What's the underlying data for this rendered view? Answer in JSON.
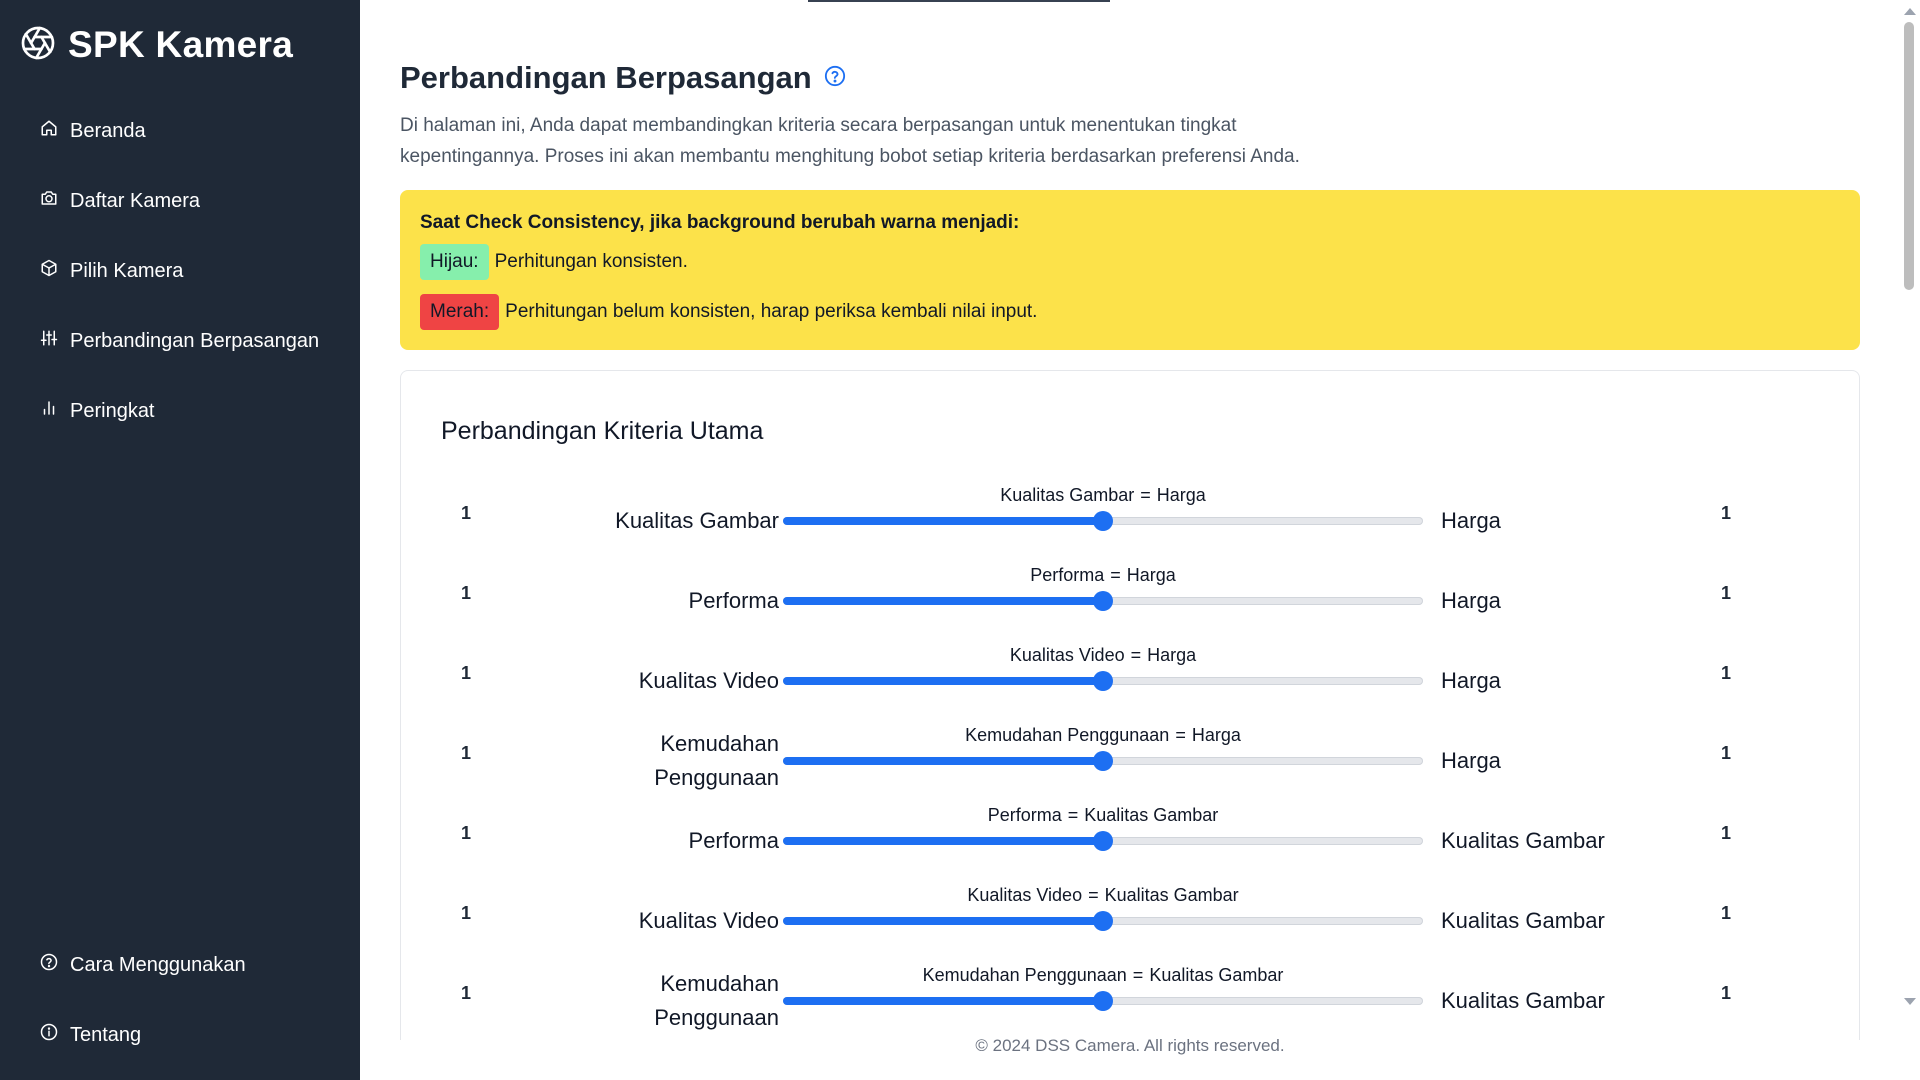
{
  "brand": {
    "name": "SPK Kamera",
    "icon": "aperture-icon"
  },
  "nav": {
    "items": [
      {
        "label": "Beranda",
        "icon": "home-icon"
      },
      {
        "label": "Daftar Kamera",
        "icon": "camera-icon"
      },
      {
        "label": "Pilih Kamera",
        "icon": "cube-icon"
      },
      {
        "label": "Perbandingan Berpasangan",
        "icon": "sliders-icon"
      },
      {
        "label": "Peringkat",
        "icon": "bar-chart-icon"
      }
    ],
    "bottom": [
      {
        "label": "Cara Menggunakan",
        "icon": "question-circle-icon"
      },
      {
        "label": "Tentang",
        "icon": "info-circle-icon"
      }
    ]
  },
  "page": {
    "title": "Perbandingan Berpasangan",
    "intro": "Di halaman ini, Anda dapat membandingkan kriteria secara berpasangan untuk menentukan tingkat kepentingannya. Proses ini akan membantu menghitung bobot setiap kriteria berdasarkan preferensi Anda."
  },
  "notice": {
    "title": "Saat Check Consistency, jika background berubah warna menjadi:",
    "green_badge": "Hijau:",
    "green_text": "Perhitungan konsisten.",
    "red_badge": "Merah:",
    "red_text": "Perhitungan belum konsisten, harap periksa kembali nilai input."
  },
  "card": {
    "title": "Perbandingan Kriteria Utama",
    "equals_sign": "=",
    "rows": [
      {
        "left_value": "1",
        "left": "Kualitas Gambar",
        "right": "Harga",
        "right_value": "1",
        "position": 0.5
      },
      {
        "left_value": "1",
        "left": "Performa",
        "right": "Harga",
        "right_value": "1",
        "position": 0.5
      },
      {
        "left_value": "1",
        "left": "Kualitas Video",
        "right": "Harga",
        "right_value": "1",
        "position": 0.5
      },
      {
        "left_value": "1",
        "left": "Kemudahan Penggunaan",
        "right": "Harga",
        "right_value": "1",
        "position": 0.5
      },
      {
        "left_value": "1",
        "left": "Performa",
        "right": "Kualitas Gambar",
        "right_value": "1",
        "position": 0.5
      },
      {
        "left_value": "1",
        "left": "Kualitas Video",
        "right": "Kualitas Gambar",
        "right_value": "1",
        "position": 0.5
      },
      {
        "left_value": "1",
        "left": "Kemudahan Penggunaan",
        "right": "Kualitas Gambar",
        "right_value": "1",
        "position": 0.5
      }
    ]
  },
  "footer": {
    "text": "© 2024 DSS Camera. All rights reserved."
  },
  "colors": {
    "sidebar": "#1f2937",
    "accent": "#1d6ff2",
    "notice": "#fce24a",
    "green": "#86efac",
    "red": "#ef4444"
  }
}
